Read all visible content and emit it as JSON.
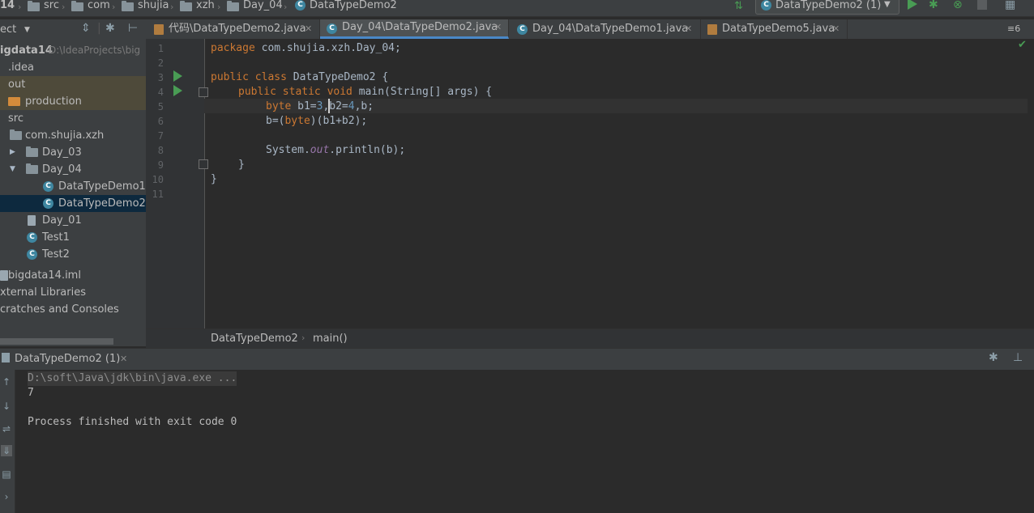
{
  "navbar": {
    "items": [
      "14",
      "src",
      "com",
      "shujia",
      "xzh",
      "Day_04",
      "DataTypeDemo2"
    ],
    "run_config": "DataTypeDemo2 (1)"
  },
  "project": {
    "header": "ect",
    "tree": [
      {
        "label": "igdata14",
        "extra": "D:\\IdeaProjects\\big"
      },
      {
        "label": ".idea"
      },
      {
        "label": "out"
      },
      {
        "label": "production"
      },
      {
        "label": "src"
      },
      {
        "label": "com.shujia.xzh"
      },
      {
        "label": "Day_03"
      },
      {
        "label": "Day_04"
      },
      {
        "label": "DataTypeDemo1"
      },
      {
        "label": "DataTypeDemo2"
      },
      {
        "label": "Day_01"
      },
      {
        "label": "Test1"
      },
      {
        "label": "Test2"
      },
      {
        "label": "bigdata14.iml"
      },
      {
        "label": "xternal Libraries"
      },
      {
        "label": "cratches and Consoles"
      }
    ]
  },
  "tabs": [
    {
      "label": "代码\\DataTypeDemo2.java"
    },
    {
      "label": "Day_04\\DataTypeDemo2.java"
    },
    {
      "label": "Day_04\\DataTypeDemo1.java"
    },
    {
      "label": "DataTypeDemo5.java"
    }
  ],
  "tab_count": "6",
  "editor": {
    "line_numbers": [
      "1",
      "2",
      "3",
      "4",
      "5",
      "6",
      "7",
      "8",
      "9",
      "10",
      "11"
    ],
    "lines": {
      "l1_kw": "package",
      "l1_rest": " com.shujia.xzh.Day_04;",
      "l3_kw": "public class",
      "l3_rest": " DataTypeDemo2 {",
      "l4_kw1": "public static void",
      "l4_rest": " main(String[] args) {",
      "l5_kw": "byte",
      "l5_a": " b1=",
      "l5_n1": "3",
      "l5_b": ",b2=",
      "l5_n2": "4",
      "l5_c": ",b;",
      "l6_a": "b=(",
      "l6_kw": "byte",
      "l6_b": ")(b1+b2);",
      "l8_a": "System.",
      "l8_it": "out",
      "l8_b": ".println(b);",
      "l9": "}",
      "l10": "}"
    },
    "crumbs": [
      "DataTypeDemo2",
      "main()"
    ]
  },
  "run": {
    "tab_label": "DataTypeDemo2 (1)",
    "command": "D:\\soft\\Java\\jdk\\bin\\java.exe ...",
    "output": "7",
    "exit": "Process finished with exit code 0"
  },
  "colors": {
    "accent": "#4a88c7",
    "run_green": "#499c54",
    "keyword": "#cc7832",
    "number": "#6897bb"
  }
}
